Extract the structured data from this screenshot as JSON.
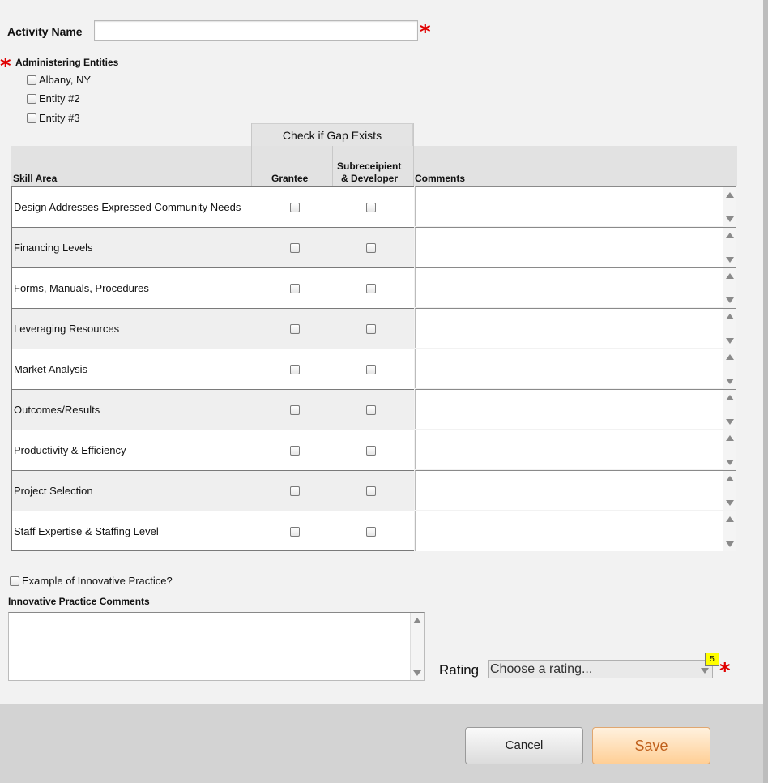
{
  "activity": {
    "label": "Activity Name",
    "value": "",
    "required_mark": "*"
  },
  "entities": {
    "label": "Administering Entities",
    "required_mark": "*",
    "options": [
      {
        "label": "Albany, NY",
        "checked": false
      },
      {
        "label": "Entity #2",
        "checked": false
      },
      {
        "label": "Entity #3",
        "checked": false
      }
    ]
  },
  "table": {
    "gap_header": "Check if Gap Exists",
    "col_skill": "Skill Area",
    "col_grantee": "Grantee",
    "col_sub_line1": "Subreceipient",
    "col_sub_line2": "& Developer",
    "col_comments": "Comments",
    "rows": [
      {
        "skill": "Design Addresses Expressed Community Needs",
        "grantee": false,
        "sub": false,
        "comment": ""
      },
      {
        "skill": "Financing Levels",
        "grantee": false,
        "sub": false,
        "comment": ""
      },
      {
        "skill": "Forms, Manuals, Procedures",
        "grantee": false,
        "sub": false,
        "comment": ""
      },
      {
        "skill": "Leveraging Resources",
        "grantee": false,
        "sub": false,
        "comment": ""
      },
      {
        "skill": "Market Analysis",
        "grantee": false,
        "sub": false,
        "comment": ""
      },
      {
        "skill": "Outcomes/Results",
        "grantee": false,
        "sub": false,
        "comment": ""
      },
      {
        "skill": "Productivity & Efficiency",
        "grantee": false,
        "sub": false,
        "comment": ""
      },
      {
        "skill": "Project Selection",
        "grantee": false,
        "sub": false,
        "comment": ""
      },
      {
        "skill": "Staff Expertise & Staffing Level",
        "grantee": false,
        "sub": false,
        "comment": ""
      }
    ]
  },
  "innovative": {
    "checkbox_label": "Example of Innovative Practice?",
    "comments_label": "Innovative Practice Comments",
    "comments_value": ""
  },
  "rating": {
    "label": "Rating",
    "placeholder": "Choose a rating...",
    "badge": "5",
    "required_mark": "*"
  },
  "buttons": {
    "cancel": "Cancel",
    "save": "Save"
  },
  "colors": {
    "required": "#e00000",
    "save_text": "#c0601c",
    "save_bg": "#ffd9a8",
    "badge_bg": "#ffff00"
  }
}
